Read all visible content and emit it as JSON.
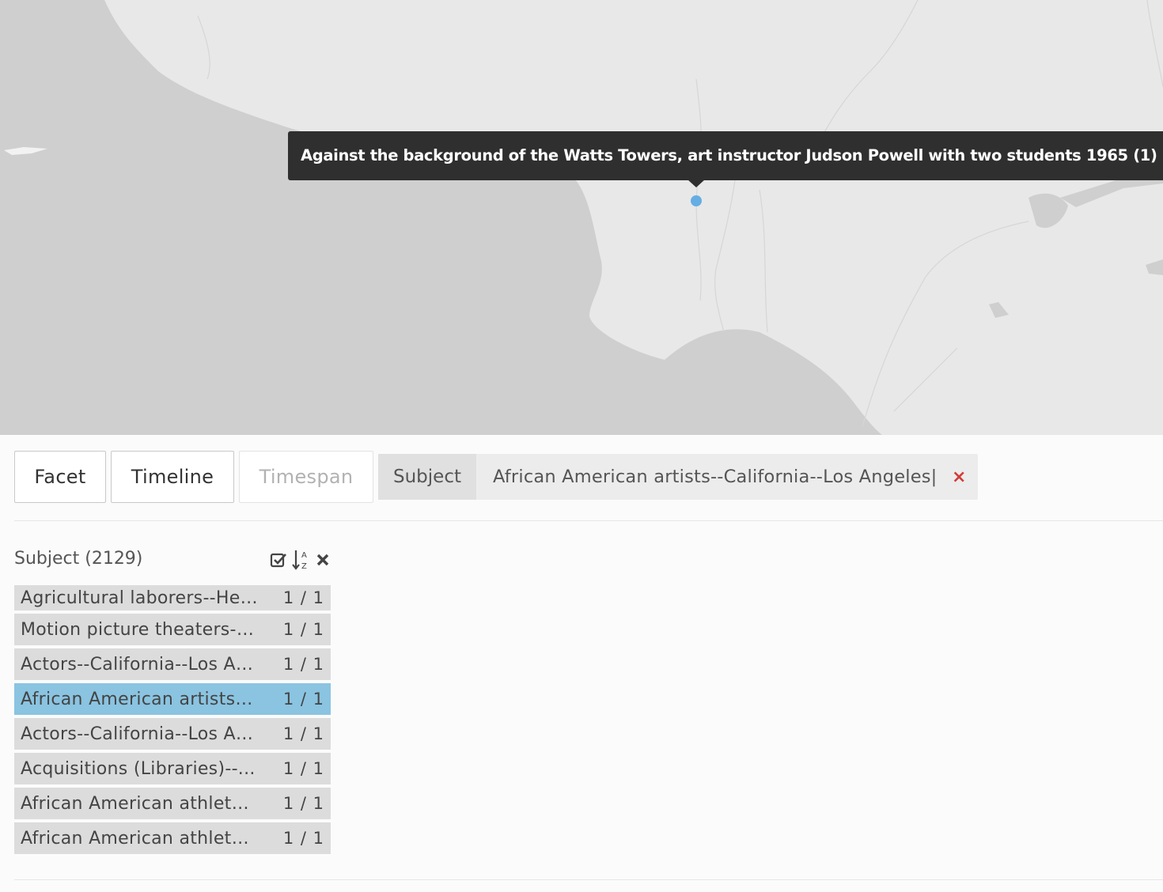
{
  "map": {
    "tooltip": "Against the background of the Watts Towers, art instructor Judson Powell with two students 1965 (1)",
    "water_color": "#cfcfcf",
    "land_color": "#e8e8e8",
    "marker_color": "#64aee4"
  },
  "toolbar": {
    "facet_label": "Facet",
    "timeline_label": "Timeline",
    "timespan_label": "Timespan"
  },
  "filter": {
    "key": "Subject",
    "value": "African American artists--California--Los Angeles|...",
    "remove_icon": "×"
  },
  "facet": {
    "title": "Subject (2129)",
    "icons": [
      "check-square-icon",
      "sort-alpha-icon",
      "close-icon"
    ],
    "items": [
      {
        "label": "Agricultural laborers--Hea...",
        "count": "1 / 1",
        "selected": false
      },
      {
        "label": "Motion picture theaters--...",
        "count": "1 / 1",
        "selected": false
      },
      {
        "label": "Actors--California--Los An...",
        "count": "1 / 1",
        "selected": false
      },
      {
        "label": "African American artists--...",
        "count": "1 / 1",
        "selected": true
      },
      {
        "label": "Actors--California--Los An...",
        "count": "1 / 1",
        "selected": false
      },
      {
        "label": "Acquisitions (Libraries)--...",
        "count": "1 / 1",
        "selected": false
      },
      {
        "label": "African American athletes...",
        "count": "1 / 1",
        "selected": false
      },
      {
        "label": "African American athletes...",
        "count": "1 / 1",
        "selected": false
      }
    ]
  }
}
